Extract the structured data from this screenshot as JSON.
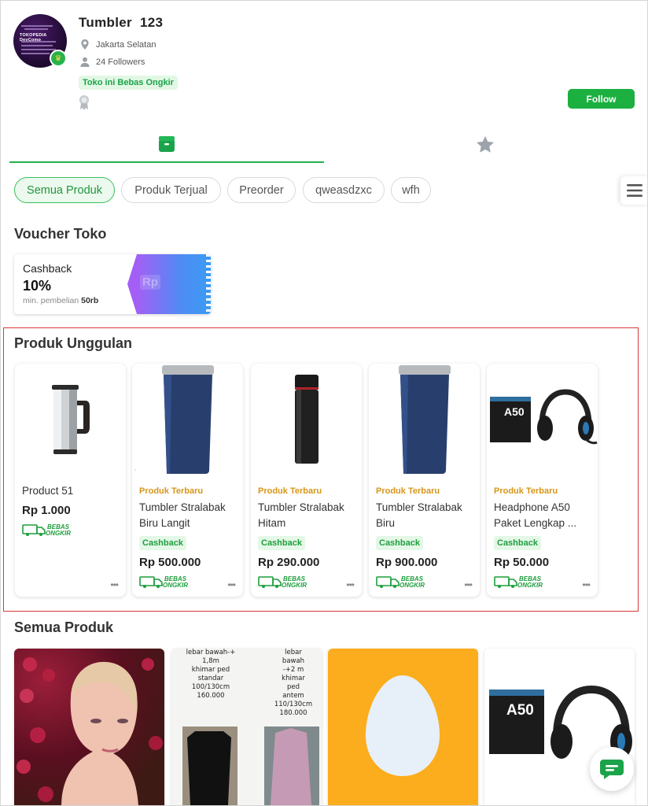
{
  "shop": {
    "name": "Tumbler  123",
    "location": "Jakarta Selatan",
    "followers": "24 Followers",
    "free_shipping_tag": "Toko ini Bebas Ongkir",
    "follow_label": "Follow",
    "avatar_text": "TOKOPEDIA DevComp"
  },
  "tabs": [
    {
      "icon": "shop-bag-icon",
      "active": true
    },
    {
      "icon": "star-icon",
      "active": false
    }
  ],
  "chips": [
    "Semua Produk",
    "Produk Terjual",
    "Preorder",
    "qweasdzxc",
    "wfh"
  ],
  "voucher_section": {
    "title": "Voucher Toko",
    "voucher": {
      "type": "Cashback",
      "value": "10%",
      "min_prefix": "min. pembelian",
      "min_value": "50rb",
      "badge": "Rp"
    }
  },
  "featured": {
    "title": "Produk Unggulan",
    "items": [
      {
        "label": "",
        "name": "Product 51",
        "cashback": "",
        "price": "Rp 1.000"
      },
      {
        "label": "Produk Terbaru",
        "name": "Tumbler Stralabak Biru Langit",
        "cashback": "Cashback",
        "price": "Rp 500.000"
      },
      {
        "label": "Produk Terbaru",
        "name": "Tumbler Stralabak Hitam",
        "cashback": "Cashback",
        "price": "Rp 290.000"
      },
      {
        "label": "Produk Terbaru",
        "name": "Tumbler Stralabak Biru",
        "cashback": "Cashback",
        "price": "Rp 900.000"
      },
      {
        "label": "Produk Terbaru",
        "name": "Headphone A50 Paket Lengkap ...",
        "cashback": "Cashback",
        "price": "Rp 50.000"
      }
    ],
    "shipping_badge": {
      "line1": "BEBAS",
      "line2": "ONGKIR"
    }
  },
  "all_products": {
    "title": "Semua Produk",
    "tile2_text": {
      "left": [
        "lebar bawah-+",
        "1,8m",
        "khimar ped",
        "standar",
        "100/130cm",
        "160.000"
      ],
      "right": [
        "lebar",
        "bawah",
        "-+2 m",
        "khimar",
        "ped",
        "antem",
        "110/130cm",
        "180.000"
      ]
    }
  },
  "colors": {
    "primary_green": "#1bb03f",
    "featured_border": "#d9383a",
    "label_orange": "#d6961a"
  }
}
